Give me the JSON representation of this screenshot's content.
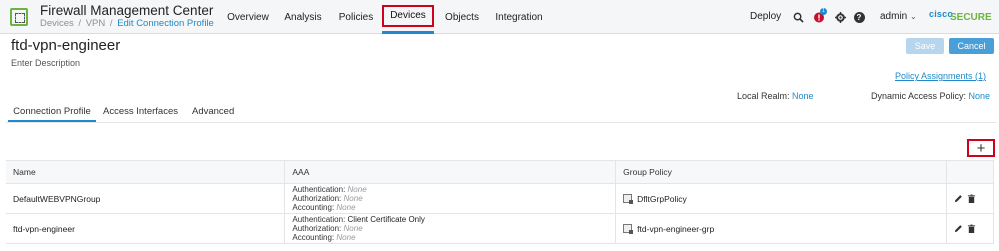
{
  "header": {
    "app_title": "Firewall Management Center",
    "breadcrumb": [
      "Devices",
      "VPN",
      "Edit Connection Profile"
    ],
    "nav": [
      "Overview",
      "Analysis",
      "Policies",
      "Devices",
      "Objects",
      "Integration"
    ],
    "active_nav": "Devices",
    "deploy_label": "Deploy",
    "notification_count": "1",
    "user": "admin",
    "brand": "SECURE",
    "brand_prefix": "cisco"
  },
  "page": {
    "title": "ftd-vpn-engineer",
    "description": "Enter Description",
    "save_label": "Save",
    "cancel_label": "Cancel",
    "policy_assignments": "Policy Assignments (1)",
    "local_realm_label": "Local Realm:",
    "local_realm_value": "None",
    "dap_label": "Dynamic Access Policy:",
    "dap_value": "None"
  },
  "tabs": [
    "Connection Profile",
    "Access Interfaces",
    "Advanced"
  ],
  "table": {
    "columns": [
      "Name",
      "AAA",
      "Group Policy",
      ""
    ],
    "rows": [
      {
        "name": "DefaultWEBVPNGroup",
        "auth_label": "Authentication:",
        "auth": "None",
        "authz_label": "Authorization:",
        "authz": "None",
        "acct_label": "Accounting:",
        "acct": "None",
        "group_policy": "DfltGrpPolicy"
      },
      {
        "name": "ftd-vpn-engineer",
        "auth_label": "Authentication:",
        "auth": "Client Certificate Only",
        "authz_label": "Authorization:",
        "authz": "None",
        "acct_label": "Accounting:",
        "acct": "None",
        "group_policy": "ftd-vpn-engineer-grp"
      }
    ]
  },
  "colors": {
    "accent": "#1f8ac9",
    "highlight": "#d0021b",
    "brand_green": "#6cb33f"
  }
}
